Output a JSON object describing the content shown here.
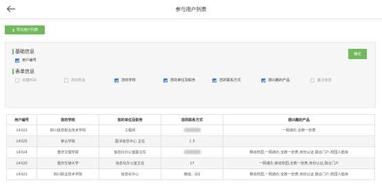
{
  "header": {
    "title": "参与用户列表"
  },
  "toolbar": {
    "export_label": "导出用户列表"
  },
  "filters": {
    "basic": {
      "title": "基础信息",
      "options": [
        {
          "label": "用户编号",
          "checked": true
        }
      ]
    },
    "form": {
      "title": "表单信息",
      "options": [
        {
          "label": "创建时间",
          "checked": false
        },
        {
          "label": "您的姓名",
          "checked": false
        },
        {
          "label": "您的学校",
          "checked": true
        },
        {
          "label": "您的单位及职务",
          "checked": true
        },
        {
          "label": "您的联系方式",
          "checked": true
        },
        {
          "label": "感兴趣的产品",
          "checked": true
        },
        {
          "label": "备注信息",
          "checked": false
        }
      ]
    },
    "confirm_label": "确定"
  },
  "table": {
    "columns": [
      "用户编号",
      "您的学校",
      "您的单位及职务",
      "您的联系方式",
      "感兴趣的产品"
    ],
    "rows": [
      [
        "14322",
        "四川信息职业技术学院",
        "工程师",
        "",
        "一网通办,全数一张表"
      ],
      [
        "14325",
        "茅台学院",
        "图书信息中心 主任",
        "1      5",
        ""
      ],
      [
        "14324",
        "重庆文理学院",
        "信息化办公室副主任",
        "",
        "移动校园,一网通办,全数一张表,身份认证,融合门户,校园人脸库"
      ],
      [
        "14320",
        "重庆交通大学",
        "信息化办公室主任",
        "17",
        "一网通办,移动校园,全数一张表,身份认证,融合门户"
      ],
      [
        "14321",
        "四川职业技术学院",
        "信息化中心",
        "微信、QQ",
        "移动校园,一网通办,全数一张表,身份认证,融合门户,校园人脸库"
      ]
    ]
  },
  "colors": {
    "accent": "#72b95c",
    "check": "#3a7fd5"
  },
  "icons": {
    "back": "arrow-left-icon",
    "export": "download-icon"
  }
}
